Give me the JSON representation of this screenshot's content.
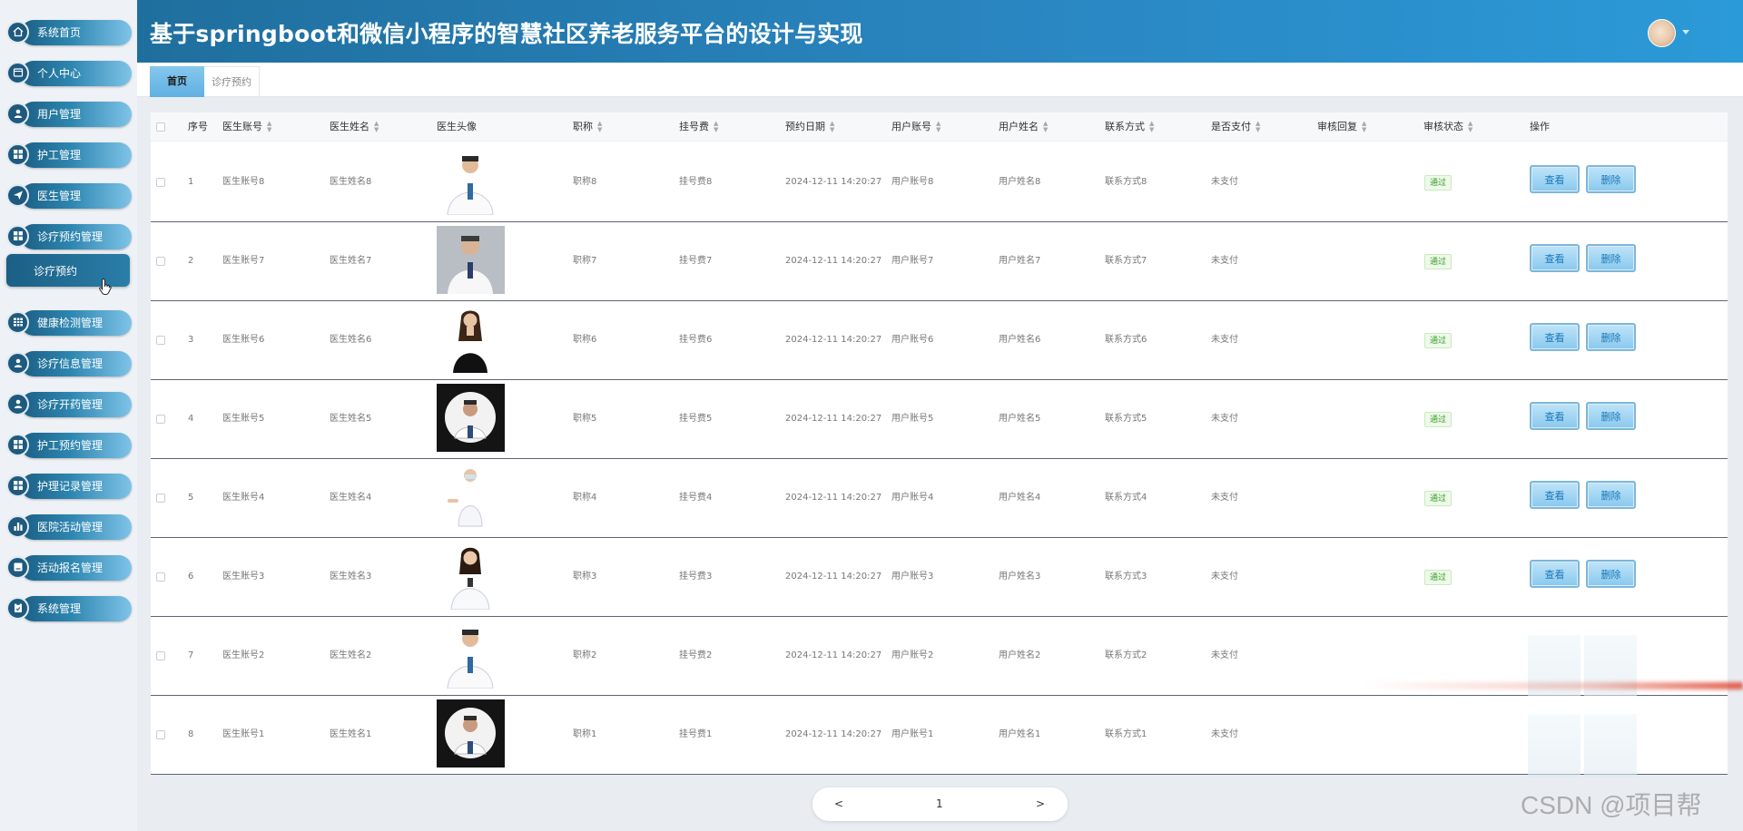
{
  "header": {
    "title": "基于springboot和微信小程序的智慧社区养老服务平台的设计与实现"
  },
  "sidebar": {
    "items": [
      {
        "label": "系统首页",
        "icon": "home-icon"
      },
      {
        "label": "个人中心",
        "icon": "profile-icon"
      },
      {
        "label": "用户管理",
        "icon": "user-icon"
      },
      {
        "label": "护工管理",
        "icon": "grid-icon"
      },
      {
        "label": "医生管理",
        "icon": "send-icon"
      },
      {
        "label": "诊疗预约管理",
        "icon": "grid-icon"
      },
      {
        "label": "健康检测管理",
        "icon": "table-icon"
      },
      {
        "label": "诊疗信息管理",
        "icon": "user-icon"
      },
      {
        "label": "诊疗开药管理",
        "icon": "user-icon"
      },
      {
        "label": "护工预约管理",
        "icon": "grid-icon"
      },
      {
        "label": "护理记录管理",
        "icon": "grid-icon"
      },
      {
        "label": "医院活动管理",
        "icon": "chart-icon"
      },
      {
        "label": "活动报名管理",
        "icon": "form-icon"
      },
      {
        "label": "系统管理",
        "icon": "settings-icon"
      }
    ],
    "sub_item": "诊疗预约"
  },
  "tabs": {
    "home": "首页",
    "current": "诊疗预约"
  },
  "table": {
    "headers": {
      "index": "序号",
      "doctor_account": "医生账号",
      "doctor_name": "医生姓名",
      "doctor_avatar": "医生头像",
      "title": "职称",
      "fee": "挂号费",
      "date": "预约日期",
      "user_account": "用户账号",
      "user_name": "用户姓名",
      "contact": "联系方式",
      "paid": "是否支付",
      "review_reply": "审核回复",
      "review_status": "审核状态",
      "actions": "操作"
    },
    "rows": [
      {
        "index": "1",
        "doctor_account": "医生账号8",
        "doctor_name": "医生姓名8",
        "title": "职称8",
        "fee": "挂号费8",
        "date": "2024-12-11 14:20:27",
        "user_account": "用户账号8",
        "user_name": "用户姓名8",
        "contact": "联系方式8",
        "paid": "未支付",
        "status": "通过"
      },
      {
        "index": "2",
        "doctor_account": "医生账号7",
        "doctor_name": "医生姓名7",
        "title": "职称7",
        "fee": "挂号费7",
        "date": "2024-12-11 14:20:27",
        "user_account": "用户账号7",
        "user_name": "用户姓名7",
        "contact": "联系方式7",
        "paid": "未支付",
        "status": "通过"
      },
      {
        "index": "3",
        "doctor_account": "医生账号6",
        "doctor_name": "医生姓名6",
        "title": "职称6",
        "fee": "挂号费6",
        "date": "2024-12-11 14:20:27",
        "user_account": "用户账号6",
        "user_name": "用户姓名6",
        "contact": "联系方式6",
        "paid": "未支付",
        "status": "通过"
      },
      {
        "index": "4",
        "doctor_account": "医生账号5",
        "doctor_name": "医生姓名5",
        "title": "职称5",
        "fee": "挂号费5",
        "date": "2024-12-11 14:20:27",
        "user_account": "用户账号5",
        "user_name": "用户姓名5",
        "contact": "联系方式5",
        "paid": "未支付",
        "status": "通过"
      },
      {
        "index": "5",
        "doctor_account": "医生账号4",
        "doctor_name": "医生姓名4",
        "title": "职称4",
        "fee": "挂号费4",
        "date": "2024-12-11 14:20:27",
        "user_account": "用户账号4",
        "user_name": "用户姓名4",
        "contact": "联系方式4",
        "paid": "未支付",
        "status": "通过"
      },
      {
        "index": "6",
        "doctor_account": "医生账号3",
        "doctor_name": "医生姓名3",
        "title": "职称3",
        "fee": "挂号费3",
        "date": "2024-12-11 14:20:27",
        "user_account": "用户账号3",
        "user_name": "用户姓名3",
        "contact": "联系方式3",
        "paid": "未支付",
        "status": "通过"
      },
      {
        "index": "7",
        "doctor_account": "医生账号2",
        "doctor_name": "医生姓名2",
        "title": "职称2",
        "fee": "挂号费2",
        "date": "2024-12-11 14:20:27",
        "user_account": "用户账号2",
        "user_name": "用户姓名2",
        "contact": "联系方式2",
        "paid": "未支付",
        "status": ""
      },
      {
        "index": "8",
        "doctor_account": "医生账号1",
        "doctor_name": "医生姓名1",
        "title": "职称1",
        "fee": "挂号费1",
        "date": "2024-12-11 14:20:27",
        "user_account": "用户账号1",
        "user_name": "用户姓名1",
        "contact": "联系方式1",
        "paid": "未支付",
        "status": ""
      }
    ],
    "view_label": "查看",
    "delete_label": "删除"
  },
  "pagination": {
    "prev": "<",
    "page": "1",
    "next": ">"
  },
  "watermark": "CSDN @项目帮"
}
